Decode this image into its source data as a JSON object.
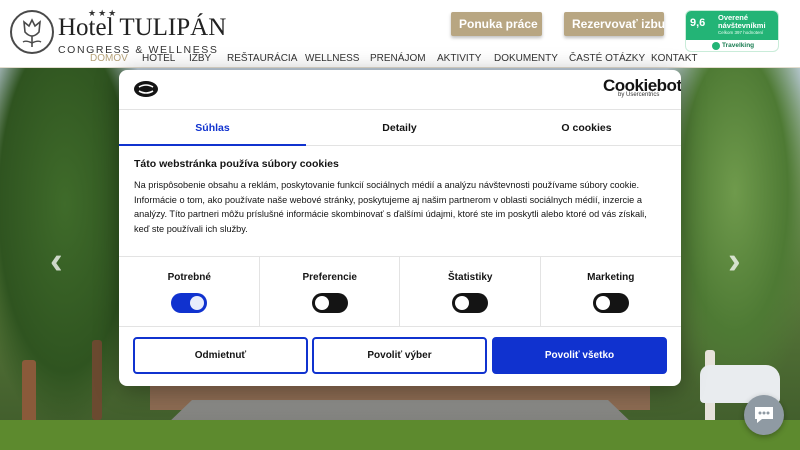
{
  "header": {
    "stars": "★★★",
    "hotel_name": "Hotel TULIPÁN",
    "hotel_subtitle": "CONGRESS & WELLNESS",
    "btn_jobs": "Ponuka práce",
    "btn_book": "Rezervovať izbu",
    "badge": {
      "score": "9,6",
      "title": "Overené návštevníkmi",
      "note": "Celkom 397 hodnotení",
      "brand": "Travelking",
      "color": "#23b476"
    }
  },
  "nav": {
    "items": [
      "DOMOV",
      "HOTEL",
      "IZBY",
      "REŠTAURÁCIA",
      "WELLNESS",
      "PRENÁJOM",
      "AKTIVITY",
      "DOKUMENTY",
      "ČASTÉ OTÁZKY",
      "KONTAKT"
    ],
    "active": "DOMOV",
    "active_color": "#b7a37a"
  },
  "slider": {
    "prev": "‹",
    "next": "›"
  },
  "cookie": {
    "brand": "Cookiebot",
    "brand_by": "by Usercentrics",
    "tabs": [
      "Súhlas",
      "Detaily",
      "O cookies"
    ],
    "active_tab": "Súhlas",
    "title": "Táto webstránka používa súbory cookies",
    "text": "Na prispôsobenie obsahu a reklám, poskytovanie funkcií sociálnych médií a analýzu návštevnosti používame súbory cookie. Informácie o tom, ako používate naše webové stránky, poskytujeme aj našim partnerom v oblasti sociálnych médií, inzercie a analýzy. Títo partneri môžu príslušné informácie skombinovať s ďalšími údajmi, ktoré ste im poskytli alebo ktoré od vás získali, keď ste používali ich služby.",
    "categories": [
      {
        "label": "Potrebné",
        "enabled": true
      },
      {
        "label": "Preferencie",
        "enabled": false
      },
      {
        "label": "Štatistiky",
        "enabled": false
      },
      {
        "label": "Marketing",
        "enabled": false
      }
    ],
    "btn_decline": "Odmietnuť",
    "btn_selection": "Povoliť výber",
    "btn_all": "Povoliť všetko",
    "accent": "#1032cf"
  }
}
